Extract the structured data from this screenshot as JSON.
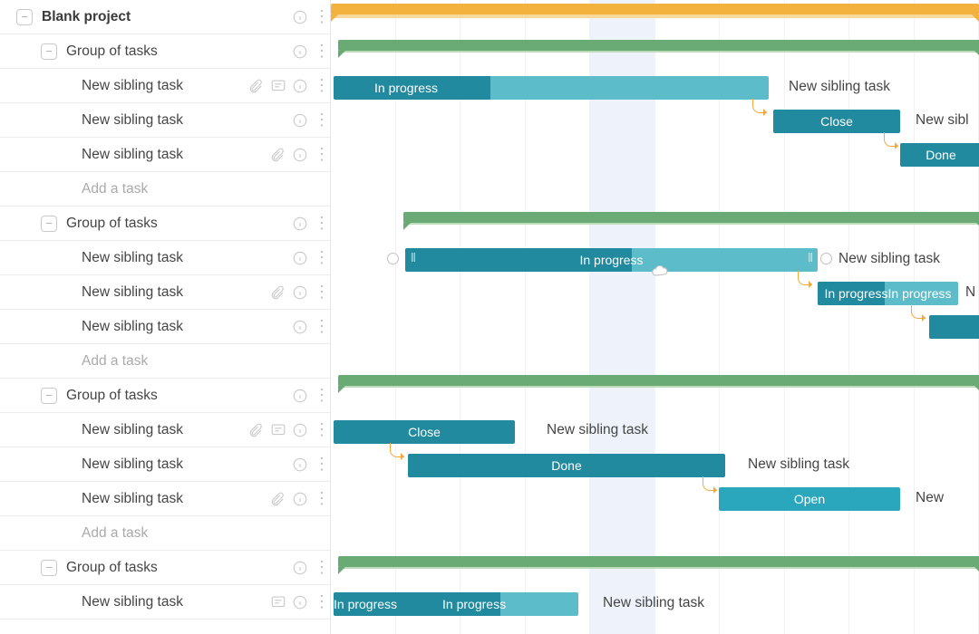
{
  "project": {
    "title": "Blank project"
  },
  "sidebar": {
    "rows": [
      {
        "type": "project",
        "label": "Blank project"
      },
      {
        "type": "group",
        "label": "Group of tasks"
      },
      {
        "type": "task",
        "label": "New sibling task",
        "attach": true,
        "comment": true
      },
      {
        "type": "task",
        "label": "New sibling task"
      },
      {
        "type": "task",
        "label": "New sibling task",
        "attach": true
      },
      {
        "type": "add",
        "label": "Add a task"
      },
      {
        "type": "group",
        "label": "Group of tasks"
      },
      {
        "type": "task",
        "label": "New sibling task"
      },
      {
        "type": "task",
        "label": "New sibling task",
        "attach": true
      },
      {
        "type": "task",
        "label": "New sibling task"
      },
      {
        "type": "add",
        "label": "Add a task"
      },
      {
        "type": "group",
        "label": "Group of tasks"
      },
      {
        "type": "task",
        "label": "New sibling task",
        "attach": true,
        "comment": true
      },
      {
        "type": "task",
        "label": "New sibling task"
      },
      {
        "type": "task",
        "label": "New sibling task",
        "attach": true
      },
      {
        "type": "add",
        "label": "Add a task"
      },
      {
        "type": "group",
        "label": "Group of tasks"
      },
      {
        "type": "task",
        "label": "New sibling task",
        "comment": true
      }
    ]
  },
  "colors": {
    "orange": "#f3b23e",
    "orangeLight": "#f9d99b",
    "green": "#6aab75",
    "greenLight": "#bddab9",
    "tealBtn": "#2aa7bd",
    "tealDark": "#218a9f",
    "tealLight": "#5dbcc9"
  },
  "status": {
    "inprogress": "In progress",
    "close": "Close",
    "done": "Done",
    "open": "Open"
  },
  "barText": {
    "nst": "New sibling task",
    "newsibl": "New sibl",
    "n": "N",
    "new": "New"
  }
}
